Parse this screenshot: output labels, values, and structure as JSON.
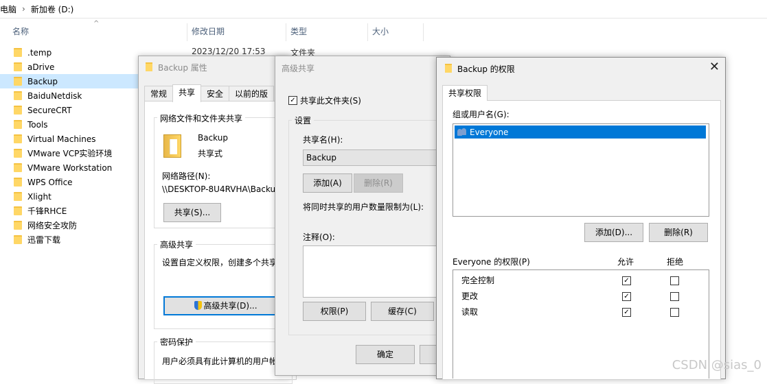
{
  "explorer": {
    "breadcrumb": [
      "电脑",
      "新加卷 (D:)"
    ],
    "columns": [
      "名称",
      "修改日期",
      "类型",
      "大小"
    ],
    "first_date": "2023/12/20 17:53",
    "first_type": "文件夹",
    "files": [
      ".temp",
      "aDrive",
      "Backup",
      "BaiduNetdisk",
      "SecureCRT",
      "Tools",
      "Virtual Machines",
      "VMware VCP实验环境",
      "VMware Workstation",
      "WPS Office",
      "Xlight",
      "千锋RHCE",
      "网络安全攻防",
      "迅雷下载"
    ],
    "selected": "Backup"
  },
  "props": {
    "title": "Backup 属性",
    "tabs": [
      "常规",
      "共享",
      "安全",
      "以前的版"
    ],
    "active_tab": "共享",
    "sharing_group": "网络文件和文件夹共享",
    "folder_name": "Backup",
    "share_state": "共享式",
    "net_path_label": "网络路径(N):",
    "net_path": "\\\\DESKTOP-8U4RVHA\\Backu",
    "share_button": "共享(S)...",
    "adv_group": "高级共享",
    "adv_desc": "设置自定义权限，创建多个共享",
    "adv_button": "高级共享(D)...",
    "pwd_group": "密码保护",
    "pwd_desc": "用户必须具有此计算机的用户帐"
  },
  "adv": {
    "title": "高级共享",
    "share_checkbox": "共享此文件夹(S)",
    "settings_group": "设置",
    "share_name_label": "共享名(H):",
    "share_name": "Backup",
    "add_button": "添加(A)",
    "remove_button": "删除(R)",
    "limit_label": "将同时共享的用户数量限制为(L):",
    "comment_label": "注释(O):",
    "perm_button": "权限(P)",
    "cache_button": "缓存(C)",
    "ok_button": "确定"
  },
  "perm": {
    "title": "Backup 的权限",
    "tab": "共享权限",
    "group_label": "组或用户名(G):",
    "users": [
      "Everyone"
    ],
    "add_button": "添加(D)...",
    "remove_button": "删除(R)",
    "perm_label": "Everyone 的权限(P)",
    "allow": "允许",
    "deny": "拒绝",
    "rows": [
      {
        "name": "完全控制",
        "allow": true,
        "deny": false
      },
      {
        "name": "更改",
        "allow": true,
        "deny": false
      },
      {
        "name": "读取",
        "allow": true,
        "deny": false
      }
    ]
  },
  "watermark": "CSDN @sias_0"
}
